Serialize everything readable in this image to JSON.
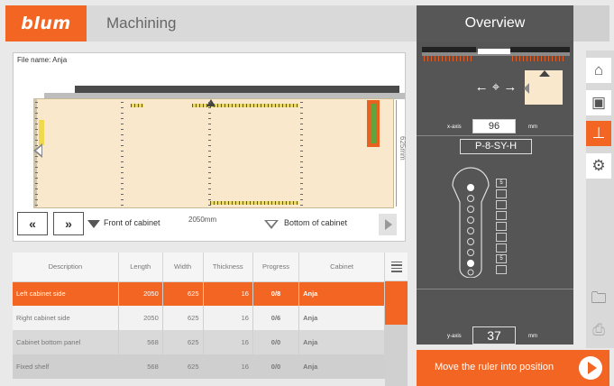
{
  "header": {
    "logo_text": "blum",
    "title": "Machining",
    "overview_title": "Overview"
  },
  "drawing": {
    "file_name": "File name: Anja",
    "height_dim": "625mm",
    "width_dim": "2050mm",
    "front_label": "Front of cabinet",
    "bottom_label": "Bottom of cabinet",
    "prev_label": "«",
    "next_label": "»"
  },
  "table": {
    "headers": [
      "Description",
      "Length",
      "Width",
      "Thickness",
      "Progress",
      "Cabinet"
    ],
    "rows": [
      {
        "description": "Left cabinet side",
        "length": "2050",
        "width": "625",
        "thickness": "16",
        "progress": "0/8",
        "cabinet": "Anja"
      },
      {
        "description": "Right cabinet side",
        "length": "2050",
        "width": "625",
        "thickness": "16",
        "progress": "0/6",
        "cabinet": "Anja"
      },
      {
        "description": "Cabinet bottom panel",
        "length": "568",
        "width": "625",
        "thickness": "16",
        "progress": "0/0",
        "cabinet": "Anja"
      },
      {
        "description": "Fixed shelf",
        "length": "568",
        "width": "625",
        "thickness": "16",
        "progress": "0/0",
        "cabinet": "Anja"
      }
    ]
  },
  "overview": {
    "x_axis_label": "x-axis",
    "x_axis_value": "96",
    "x_unit": "mm",
    "template_code": "P-8-SY-H",
    "slot_label_top": "5",
    "slot_label_bottom": "5",
    "y_axis_label": "y-axis",
    "y_axis_value": "37",
    "y_unit": "mm"
  },
  "action": {
    "label": "Move the ruler into position"
  },
  "sidebar": {
    "icons": [
      "home-icon",
      "cabinet-icon",
      "ruler-icon",
      "settings-icon",
      "folder-icon",
      "save-icon"
    ]
  },
  "colors": {
    "accent": "#f26522",
    "panel_dark": "#555555"
  }
}
